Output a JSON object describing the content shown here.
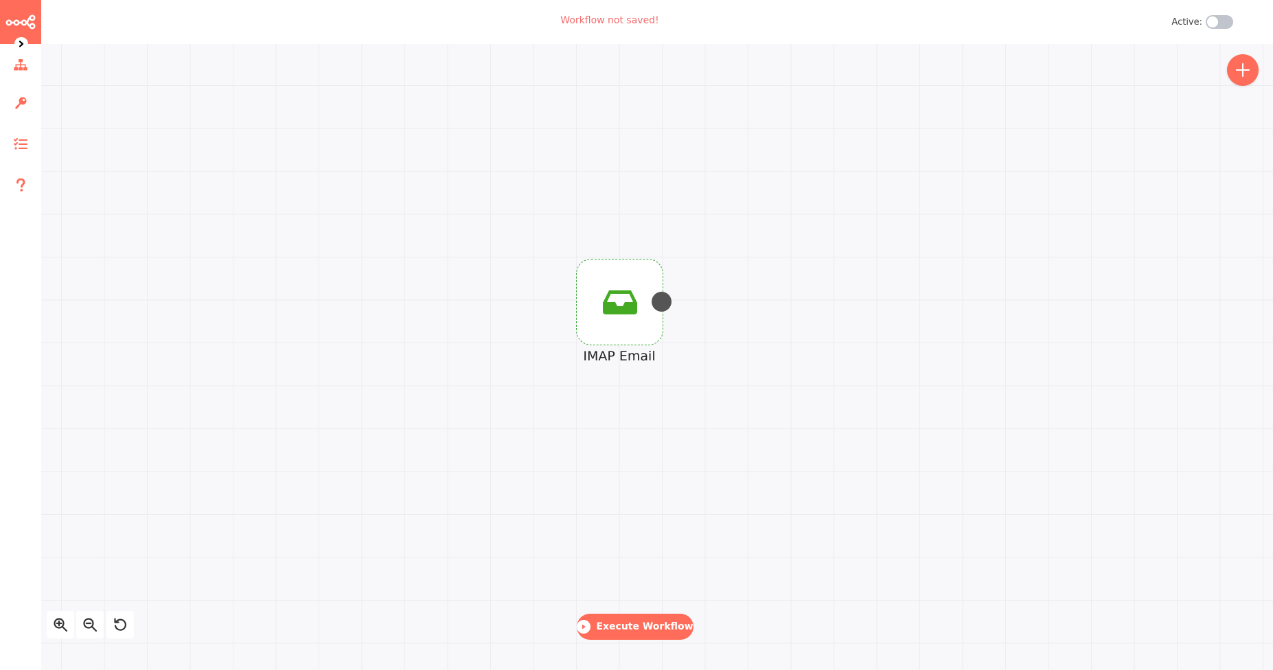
{
  "app": {
    "name": "n8n",
    "accent_color": "#ff6d5a"
  },
  "sidebar": {
    "logo_icon": "n8n-logo-icon",
    "expand_icon": "chevron-right-icon",
    "items": [
      {
        "icon": "workflows-sitemap-icon"
      },
      {
        "icon": "key-icon"
      },
      {
        "icon": "tasks-list-icon"
      },
      {
        "icon": "question-icon"
      }
    ]
  },
  "header": {
    "save_status": "Workflow not saved!",
    "active_label": "Active:",
    "active_toggle_on": false
  },
  "canvas": {
    "add_node_icon": "plus-icon",
    "nodes": [
      {
        "label": "IMAP Email",
        "icon": "inbox-icon",
        "icon_color": "#44aa22"
      }
    ]
  },
  "controls": {
    "zoom_in_icon": "zoom-in-icon",
    "zoom_out_icon": "zoom-out-icon",
    "reset_zoom_icon": "undo-icon",
    "execute_label": "Execute Workflow",
    "execute_icon": "play-circle-icon"
  }
}
